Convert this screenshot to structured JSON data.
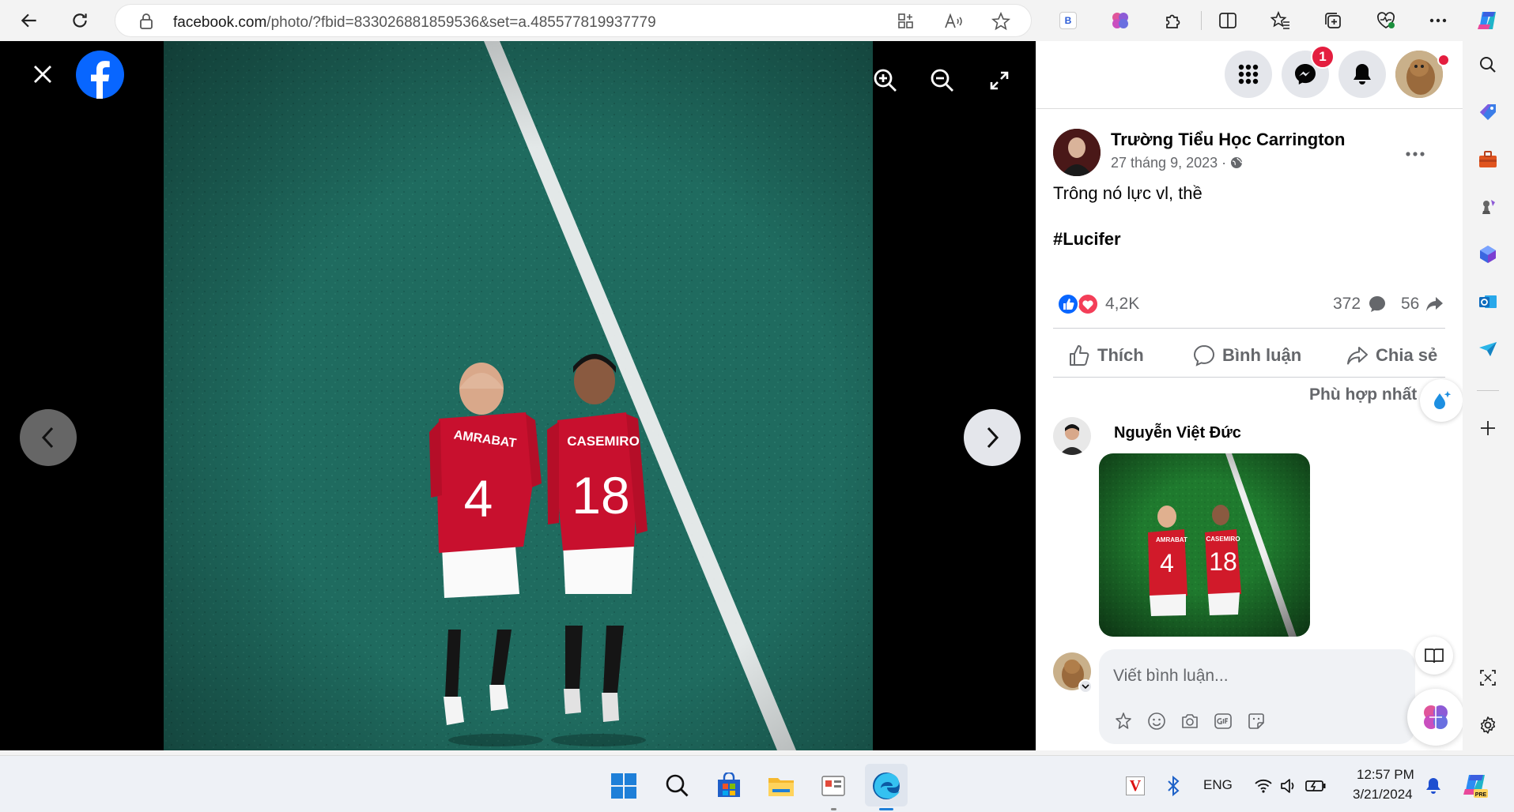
{
  "browser": {
    "url_domain": "facebook.com",
    "url_path": "/photo/?fbid=833026881859536&set=a.485577819937779"
  },
  "viewer": {
    "photo_players": [
      {
        "name": "AMRABAT",
        "number": "4"
      },
      {
        "name": "CASEMIRO",
        "number": "18"
      }
    ]
  },
  "header": {
    "messenger_badge": "1"
  },
  "post": {
    "author": "Trường Tiểu Học Carrington",
    "date": "27 tháng 9, 2023 · ",
    "text_line1": "Trông nó lực vl, thề",
    "hashtag": "#Lucifer",
    "reactions_count": "4,2K",
    "comments_count": "372",
    "shares_count": "56",
    "actions": {
      "like": "Thích",
      "comment": "Bình luận",
      "share": "Chia sẻ"
    },
    "sort_label": "Phù hợp nhất"
  },
  "comment": {
    "author": "Nguyễn Việt Đức",
    "image_players": [
      {
        "name": "AMRABAT",
        "number": "4"
      },
      {
        "name": "CASEMIRO",
        "number": "18"
      }
    ]
  },
  "composer": {
    "placeholder": "Viết bình luận..."
  },
  "taskbar": {
    "language": "ENG",
    "time": "12:57 PM",
    "date": "3/21/2024"
  },
  "colors": {
    "facebook_blue": "#0866ff",
    "pitch": "#1e6b5f",
    "jersey_red": "#c8102e",
    "notification_red": "#e41e3f"
  }
}
